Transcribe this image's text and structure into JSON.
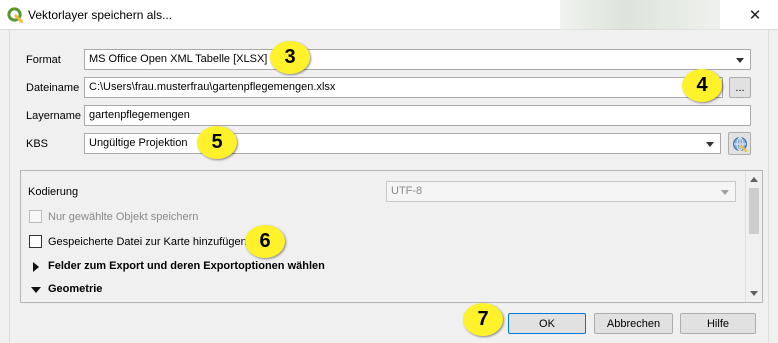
{
  "window": {
    "title": "Vektorlayer speichern als...",
    "close_glyph": "✕"
  },
  "form": {
    "format_label": "Format",
    "format_value": "MS Office Open XML Tabelle [XLSX]",
    "filename_label": "Dateiname",
    "filename_value": "C:\\Users\\frau.musterfrau\\gartenpflegemengen.xlsx",
    "browse_label": "...",
    "layername_label": "Layername",
    "layername_value": "gartenpflegemengen",
    "crs_label": "KBS",
    "crs_value": "Ungültige Projektion"
  },
  "panel": {
    "encoding_label": "Kodierung",
    "encoding_value": "UTF-8",
    "only_selected_label": "Nur gewählte Objekt speichern",
    "add_to_map_label": "Gespeicherte Datei zur Karte hinzufügen",
    "fields_section_label": "Felder zum Export und deren Exportoptionen wählen",
    "geometry_section_label": "Geometrie"
  },
  "buttons": {
    "ok": "OK",
    "cancel": "Abbrechen",
    "help": "Hilfe"
  },
  "annotations": {
    "n3": "3",
    "n4": "4",
    "n5": "5",
    "n6": "6",
    "n7": "7"
  },
  "icons": {
    "app": "qgis-logo-icon",
    "close": "close-icon",
    "crs_select": "globe-icon",
    "collapsed": "triangle-right-icon",
    "expanded": "triangle-down-icon"
  },
  "colors": {
    "annotation_badge": "#fff22a",
    "qgis_green": "#589632",
    "qgis_yellow": "#eebd3b",
    "default_button_border": "#0078d7"
  }
}
